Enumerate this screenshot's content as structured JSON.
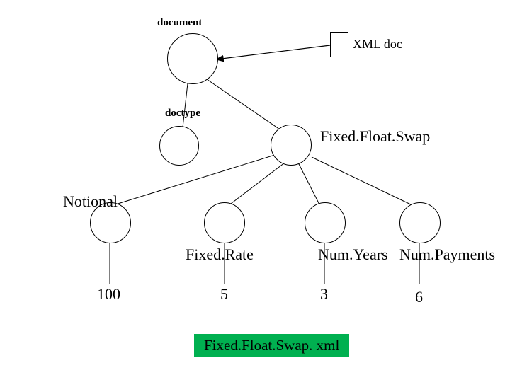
{
  "diagram": {
    "nodes": {
      "document": {
        "label": "document"
      },
      "xml_doc": {
        "label": "XML doc"
      },
      "doctype": {
        "label": "doctype"
      },
      "root": {
        "label": "Fixed.Float.Swap"
      },
      "notional": {
        "label": "Notional",
        "value": "100"
      },
      "fixedrate": {
        "label": "Fixed.Rate",
        "value": "5"
      },
      "numyears": {
        "label": "Num.Years",
        "value": "3"
      },
      "numpayments": {
        "label": "Num.Payments",
        "value": "6"
      }
    },
    "caption": "Fixed.Float.Swap. xml"
  },
  "chart_data": {
    "type": "table",
    "title": "Fixed.Float.Swap. xml",
    "description": "XML document tree for Fixed.Float.Swap",
    "nodes": [
      {
        "id": "document",
        "label": "document"
      },
      {
        "id": "xml_doc",
        "label": "XML doc"
      },
      {
        "id": "doctype",
        "label": "doctype"
      },
      {
        "id": "root",
        "label": "Fixed.Float.Swap"
      },
      {
        "id": "notional",
        "label": "Notional",
        "value": 100
      },
      {
        "id": "fixedrate",
        "label": "Fixed.Rate",
        "value": 5
      },
      {
        "id": "numyears",
        "label": "Num.Years",
        "value": 3
      },
      {
        "id": "numpayments",
        "label": "Num.Payments",
        "value": 6
      }
    ],
    "edges": [
      {
        "from": "xml_doc",
        "to": "document",
        "directed": true
      },
      {
        "from": "document",
        "to": "doctype"
      },
      {
        "from": "document",
        "to": "root"
      },
      {
        "from": "root",
        "to": "notional"
      },
      {
        "from": "root",
        "to": "fixedrate"
      },
      {
        "from": "root",
        "to": "numyears"
      },
      {
        "from": "root",
        "to": "numpayments"
      },
      {
        "from": "notional",
        "to": "notional.value"
      },
      {
        "from": "fixedrate",
        "to": "fixedrate.value"
      },
      {
        "from": "numyears",
        "to": "numyears.value"
      },
      {
        "from": "numpayments",
        "to": "numpayments.value"
      }
    ]
  }
}
